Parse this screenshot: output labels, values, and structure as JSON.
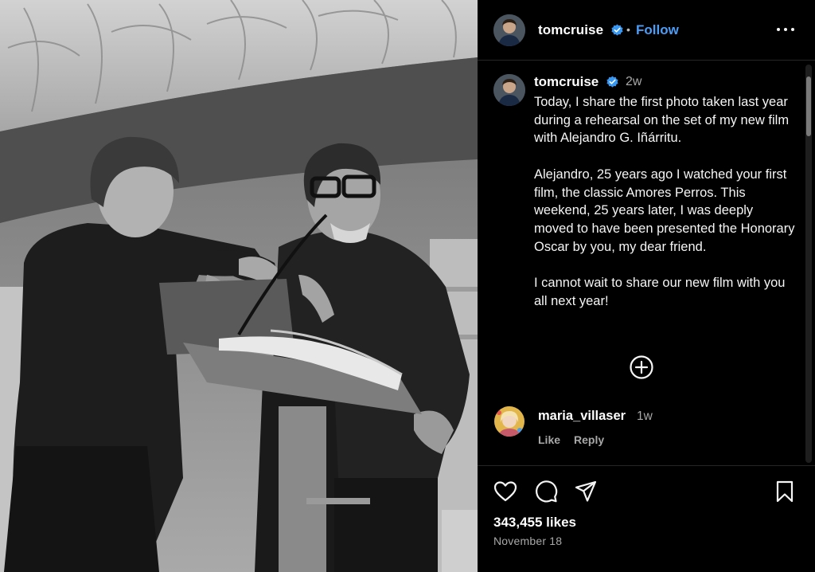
{
  "post": {
    "image_alt": "Black and white photo of two men leaning on a lectern with an open book and microphone"
  },
  "header": {
    "username": "tomcruise",
    "separator": "•",
    "follow_label": "Follow"
  },
  "caption": {
    "username": "tomcruise",
    "time_ago": "2w",
    "paragraphs": [
      "Today, I share the first photo taken last year during a rehearsal on the set of my new film with Alejandro G. Iñárritu.",
      "Alejandro, 25 years ago I watched your first film, the classic Amores Perros. This weekend, 25 years later, I was deeply moved to have been presented the Honorary Oscar by you, my dear friend.",
      "I cannot wait to share our new film with you all next year!"
    ]
  },
  "comments": [
    {
      "username": "maria_villaser",
      "time_ago": "1w",
      "like_label": "Like",
      "reply_label": "Reply"
    }
  ],
  "footer": {
    "likes": "343,455 likes",
    "date": "November 18"
  },
  "icons": {
    "more": "more-options-icon",
    "verified": "verified-badge-icon",
    "add": "plus-circle-icon",
    "like": "heart-icon",
    "comment": "comment-icon",
    "share": "send-icon",
    "save": "bookmark-icon"
  },
  "colors": {
    "background": "#000000",
    "accent": "#4b9df5",
    "verified": "#3897f0",
    "secondary_text": "#a8a8a8"
  }
}
